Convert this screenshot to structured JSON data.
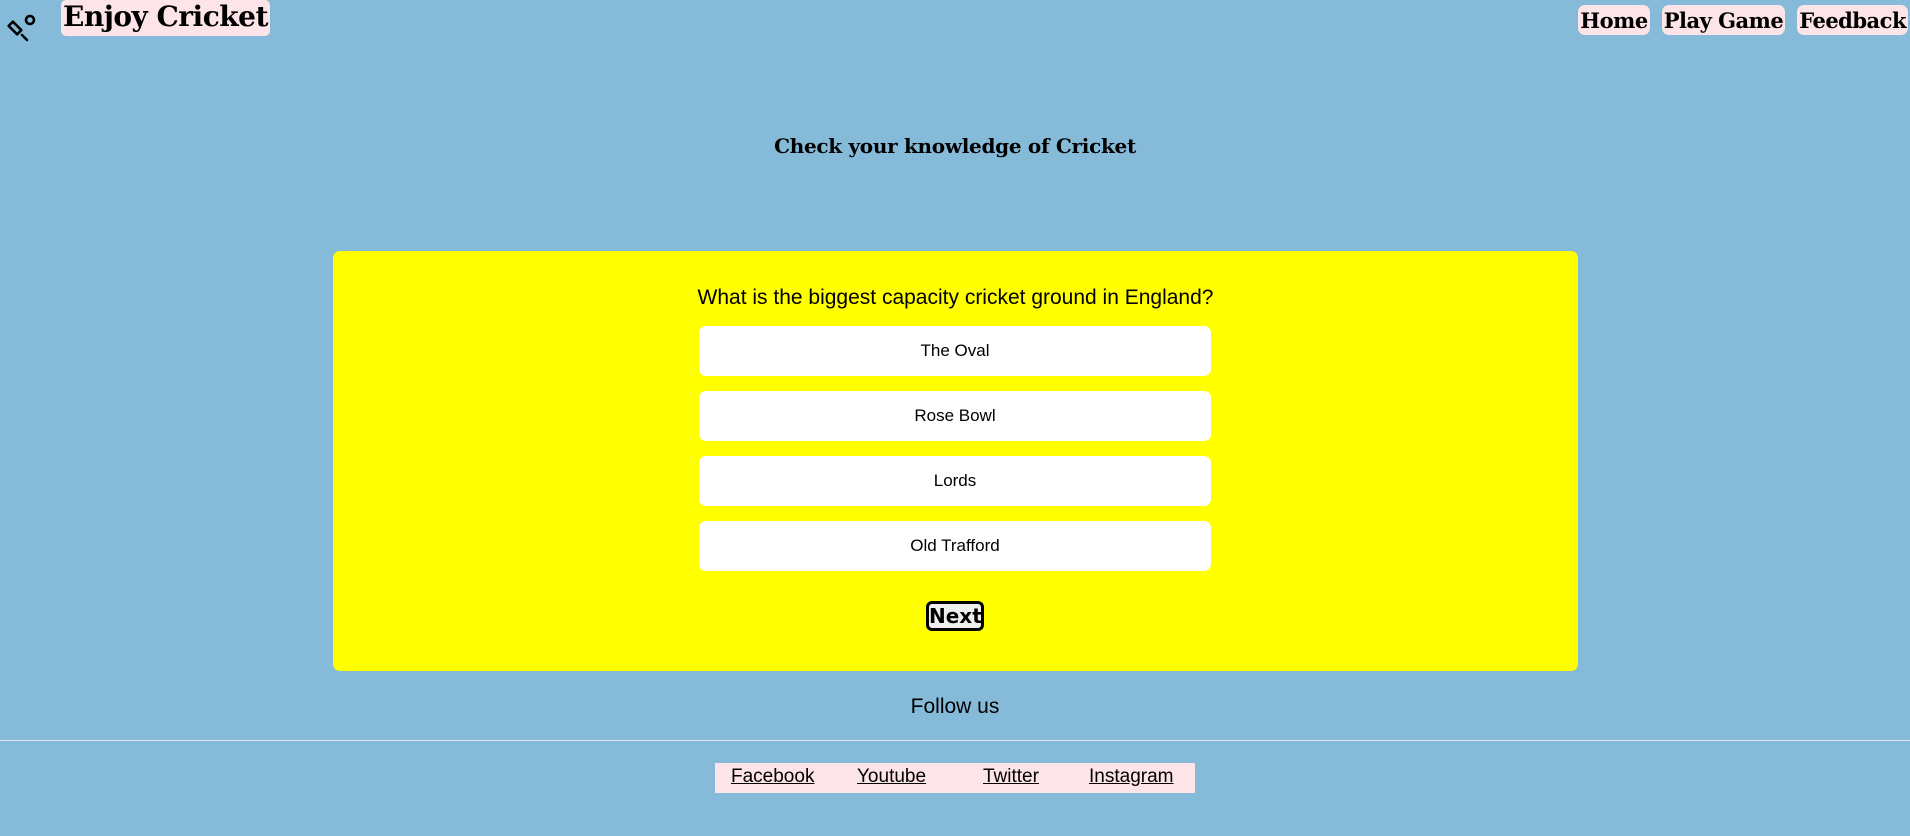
{
  "header": {
    "logo_icon": "cricket-bat-ball-icon",
    "title": "Enjoy Cricket",
    "nav": [
      {
        "label": "Home"
      },
      {
        "label": "Play Game"
      },
      {
        "label": "Feedback"
      }
    ]
  },
  "main": {
    "subtitle": "Check your knowledge of Cricket",
    "quiz": {
      "question": "What is the biggest capacity cricket ground in England?",
      "answers": [
        {
          "label": "The Oval"
        },
        {
          "label": "Rose Bowl"
        },
        {
          "label": "Lords"
        },
        {
          "label": "Old Trafford"
        }
      ],
      "next_label": "Next"
    }
  },
  "footer": {
    "follow_text": "Follow us",
    "links": [
      {
        "label": "Facebook"
      },
      {
        "label": "Youtube"
      },
      {
        "label": "Twitter"
      },
      {
        "label": "Instagram"
      }
    ]
  },
  "colors": {
    "page_background": "#85bbd9",
    "quiz_card": "#ffff00",
    "pink_highlight": "#fde4e8",
    "answer_background": "#ffffff"
  }
}
